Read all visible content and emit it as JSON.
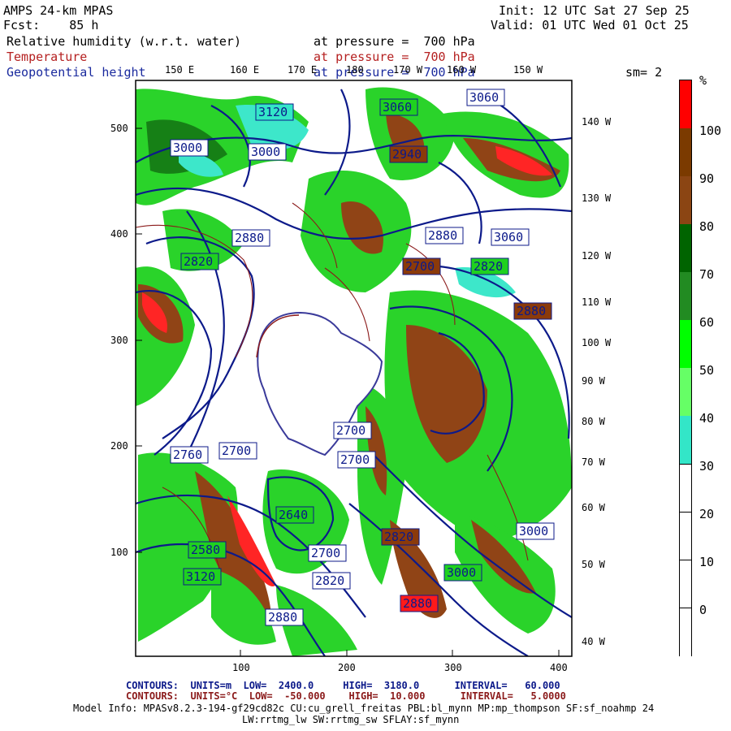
{
  "header": {
    "model": "AMPS 24-km MPAS",
    "forecast": "Fcst:    85 h",
    "init": "Init: 12 UTC Sat 27 Sep 25",
    "valid": "Valid: 01 UTC Wed 01 Oct 25",
    "field1": "Relative humidity (w.r.t. water)",
    "field2": "Temperature",
    "field3": "Geopotential height",
    "pressure_label": "at pressure =  700 hPa",
    "smoothing": "sm= 2"
  },
  "top_lon_labels": [
    "150 E",
    "160 E",
    "170 E",
    "180",
    "170 W",
    "160 W",
    "150 W"
  ],
  "right_lon_labels": [
    "140 W",
    "130 W",
    "120 W",
    "110 W",
    "100 W",
    "90 W",
    "80 W",
    "70 W",
    "60 W",
    "50 W",
    "40 W"
  ],
  "y_ticks": [
    "500",
    "400",
    "300",
    "200",
    "100"
  ],
  "x_ticks": [
    "100",
    "200",
    "300",
    "400"
  ],
  "colorbar": {
    "unit": "%",
    "labels": [
      "100",
      "90",
      "80",
      "70",
      "60",
      "50",
      "40",
      "30",
      "20",
      "10",
      "0"
    ],
    "colors": [
      "#ff0000",
      "#7b3a00",
      "#8b4513",
      "#006400",
      "#228b22",
      "#00ff00",
      "#66ff66",
      "#33e6c8",
      "#ffffff",
      "#ffffff",
      "#ffffff",
      "#ffffff"
    ]
  },
  "height_labels": [
    "3120",
    "3060",
    "3060",
    "3000",
    "3000",
    "2940",
    "2880",
    "2820",
    "2700",
    "2880",
    "3060",
    "2820",
    "2700",
    "2820",
    "2760",
    "2700",
    "2700",
    "2880",
    "2820",
    "3000",
    "3000",
    "2880",
    "2640",
    "2700",
    "2820",
    "2880",
    "3120",
    "2580"
  ],
  "footer": {
    "line1_a": "CONTOURS:  UNITS=m  LOW=  2400.0     HIGH=  3180.0      INTERVAL=   60.000",
    "line2_a": "CONTOURS:  UNITS=°C  LOW=  -50.000    HIGH=  10.000      INTERVAL=   5.0000",
    "model_info": "Model Info: MPASv8.2.3-194-gf29cd82c CU:cu_grell_freitas PBL:bl_mynn MP:mp_thompson SF:sf_noahmp 24",
    "model_info2": "LW:rrtmg_lw SW:rrtmg_sw SFLAY:sf_mynn"
  },
  "colors": {
    "height_contour": "#0c1a8a",
    "temperature_contour": "#8b1a1a",
    "footer_blue": "#0c1a8a",
    "footer_red": "#b52020"
  }
}
